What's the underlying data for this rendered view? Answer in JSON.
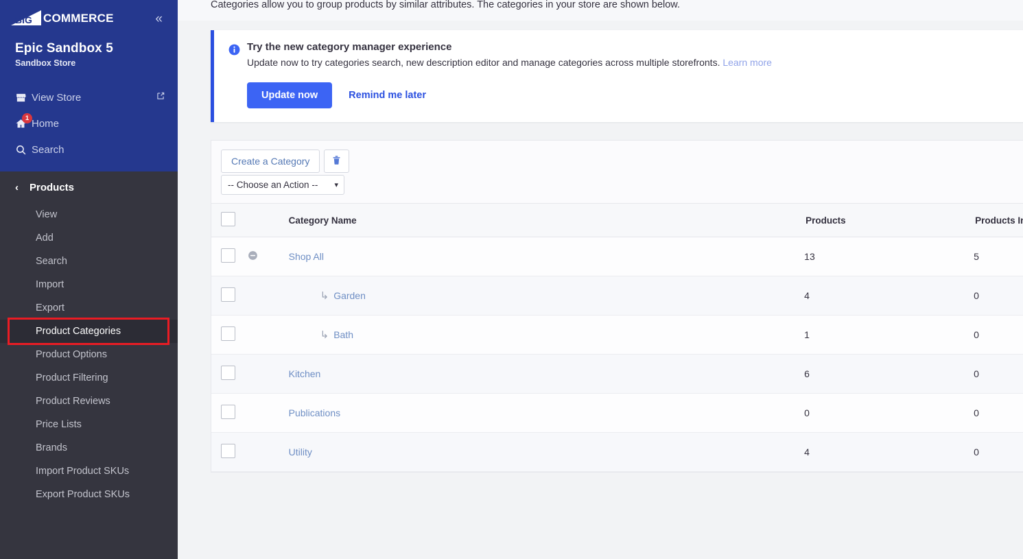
{
  "sidebar": {
    "logo_text": "COMMERCE",
    "logo_mark": "BIG",
    "collapse_icon": "chevron-double-left-icon",
    "store": {
      "name": "Epic Sandbox 5",
      "subtitle": "Sandbox Store"
    },
    "links": [
      {
        "label": "View Store",
        "icon": "store-icon",
        "external_icon": "external-link-icon",
        "badge": ""
      },
      {
        "label": "Home",
        "icon": "home-icon",
        "external_icon": "",
        "badge": "1"
      },
      {
        "label": "Search",
        "icon": "search-icon",
        "external_icon": "",
        "badge": ""
      }
    ],
    "section": {
      "title": "Products",
      "back_icon": "chevron-left-icon",
      "items": [
        {
          "label": "View",
          "active": false
        },
        {
          "label": "Add",
          "active": false
        },
        {
          "label": "Search",
          "active": false
        },
        {
          "label": "Import",
          "active": false
        },
        {
          "label": "Export",
          "active": false
        },
        {
          "label": "Product Categories",
          "active": true
        },
        {
          "label": "Product Options",
          "active": false
        },
        {
          "label": "Product Filtering",
          "active": false
        },
        {
          "label": "Product Reviews",
          "active": false
        },
        {
          "label": "Price Lists",
          "active": false
        },
        {
          "label": "Brands",
          "active": false
        },
        {
          "label": "Import Product SKUs",
          "active": false
        },
        {
          "label": "Export Product SKUs",
          "active": false
        }
      ]
    },
    "colors": {
      "top_bg": "#25388e",
      "bottom_bg": "#35353f",
      "highlight": "#ea1c24",
      "badge": "#d9373f"
    }
  },
  "main": {
    "intro_text": "Categories allow you to group products by similar attributes. The categories in your store are shown below.",
    "banner": {
      "icon": "info-circle-icon",
      "title": "Try the new category manager experience",
      "description": "Update now to try categories search, new description editor and manage categories across multiple storefronts.",
      "learn_more": "Learn more",
      "primary_button": "Update now",
      "secondary_button": "Remind me later",
      "accent_color": "#2a4fe0",
      "primary_color": "#3c64f4"
    },
    "toolbar": {
      "create_button": "Create a Category",
      "delete_icon": "trash-icon",
      "action_select_value": "-- Choose an Action --",
      "action_select_options": [
        "-- Choose an Action --"
      ],
      "chevron_icon": "chevron-down-icon"
    },
    "table": {
      "columns": [
        "Category Name",
        "Products",
        "Products In Sub Cats"
      ],
      "select_all_icon": "checkbox-icon",
      "rows": [
        {
          "name": "Shop All",
          "products": "13",
          "sub_products": "5",
          "indent": 0,
          "tree_icon": "minus-circle-icon",
          "child_icon": ""
        },
        {
          "name": "Garden",
          "products": "4",
          "sub_products": "0",
          "indent": 1,
          "tree_icon": "",
          "child_icon": "arrow-child-icon"
        },
        {
          "name": "Bath",
          "products": "1",
          "sub_products": "0",
          "indent": 1,
          "tree_icon": "",
          "child_icon": "arrow-child-icon"
        },
        {
          "name": "Kitchen",
          "products": "6",
          "sub_products": "0",
          "indent": 0,
          "tree_icon": "",
          "child_icon": ""
        },
        {
          "name": "Publications",
          "products": "0",
          "sub_products": "0",
          "indent": 0,
          "tree_icon": "",
          "child_icon": ""
        },
        {
          "name": "Utility",
          "products": "4",
          "sub_products": "0",
          "indent": 0,
          "tree_icon": "",
          "child_icon": ""
        }
      ]
    }
  }
}
